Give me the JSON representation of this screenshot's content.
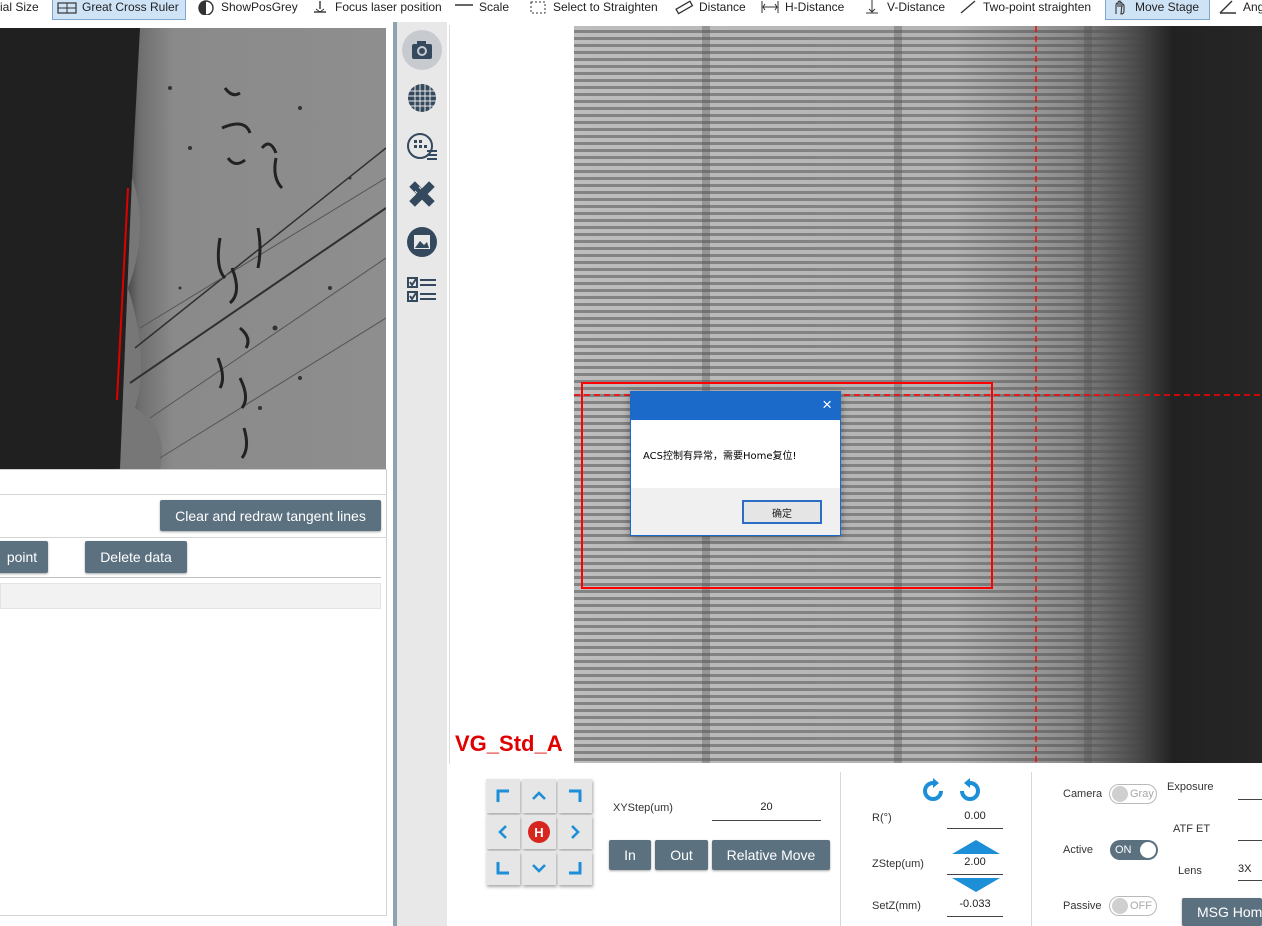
{
  "toolbar": {
    "items": [
      {
        "label": "ial Size",
        "icon": "actual-size-icon"
      },
      {
        "label": "Great Cross Ruler",
        "icon": "cross-ruler-icon",
        "active": true
      },
      {
        "label": "ShowPosGrey",
        "icon": "half-circle-icon"
      },
      {
        "label": "Focus laser position",
        "icon": "laser-icon"
      },
      {
        "label": "Scale",
        "icon": "scale-icon"
      },
      {
        "label": "Select to Straighten",
        "icon": "select-straighten-icon"
      },
      {
        "label": "Distance",
        "icon": "ruler-icon"
      },
      {
        "label": "H-Distance",
        "icon": "h-distance-icon"
      },
      {
        "label": "V-Distance",
        "icon": "v-distance-icon"
      },
      {
        "label": "Two-point straighten",
        "icon": "two-point-icon"
      },
      {
        "label": "Move Stage",
        "icon": "hand-icon",
        "active": true
      },
      {
        "label": "Ang",
        "icon": "angle-icon"
      }
    ]
  },
  "left": {
    "clear_button": "Clear and redraw tangent lines",
    "point_button": "point",
    "delete_button": "Delete data"
  },
  "iconbar": [
    "camera-icon",
    "grid-globe-icon",
    "target-grid-icon",
    "ruler-pencil-icon",
    "image-frame-icon",
    "checklist-icon"
  ],
  "view": {
    "label": "VG_Std_A",
    "accent": "#e00000"
  },
  "dialog": {
    "message": "ACS控制有异常，需要Home复位!",
    "ok": "确定",
    "close": "×"
  },
  "controls": {
    "xystep_label": "XYStep(um)",
    "xystep_value": "20",
    "in": "In",
    "out": "Out",
    "relative_move": "Relative Move",
    "r_label": "R(°)",
    "r_value": "0.00",
    "zstep_label": "ZStep(um)",
    "zstep_value": "2.00",
    "setz_label": "SetZ(mm)",
    "setz_value": "-0.033",
    "home_symbol": "H",
    "camera_label": "Camera",
    "camera_toggle": "Gray",
    "exposure_label": "Exposure",
    "atf_label": "ATF ET",
    "active_label": "Active",
    "active_toggle": "ON",
    "lens_label": "Lens",
    "lens_value": "3X",
    "passive_label": "Passive",
    "passive_toggle": "OFF",
    "msg_home": "MSG Hom"
  },
  "colors": {
    "slate_button": "#5b7180",
    "dialog_title": "#1b6ac9",
    "arrow_blue": "#1d8fd8",
    "home_red": "#d7261e",
    "overlay_red": "#ff0000"
  }
}
